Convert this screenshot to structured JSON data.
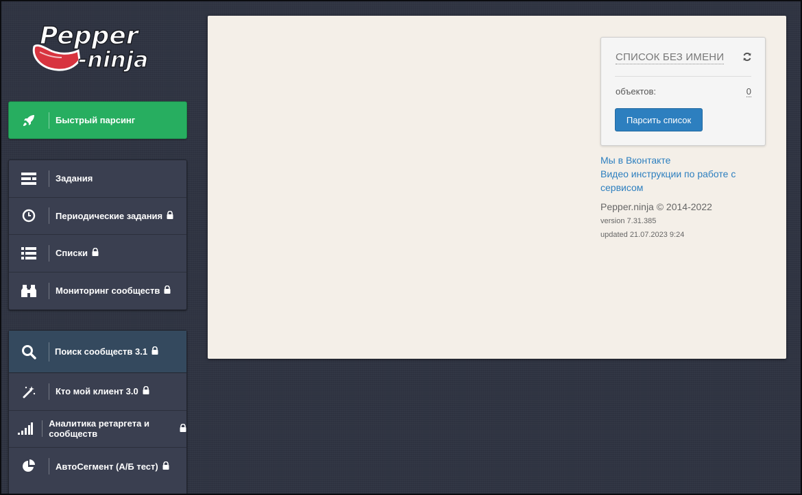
{
  "app": {
    "logo_text_line1": "Pepper",
    "logo_text_line2": "-ninja",
    "colors": {
      "sidebar_bg": "#2f3442",
      "menu_bg": "#3a3f50",
      "active_bg": "#34495e",
      "quick_green": "#27ae60",
      "content_bg": "#f4efe8",
      "link_blue": "#2d7fbf"
    }
  },
  "sidebar": {
    "quick": {
      "label": "Быстрый парсинг",
      "icon": "rocket-icon"
    },
    "group1": [
      {
        "label": "Задания",
        "icon": "tasks-icon",
        "locked": false
      },
      {
        "label": "Периодические задания",
        "icon": "clock-icon",
        "locked": true
      },
      {
        "label": "Списки",
        "icon": "list-icon",
        "locked": true
      },
      {
        "label": "Мониторинг сообществ",
        "icon": "binoculars-icon",
        "locked": true
      }
    ],
    "group2": [
      {
        "label": "Поиск сообществ 3.1",
        "icon": "search-icon",
        "locked": true,
        "active": true
      },
      {
        "label": "Кто мой клиент 3.0",
        "icon": "magic-wand-icon",
        "locked": true
      },
      {
        "label": "Аналитика ретаргета и сообществ",
        "icon": "signal-bars-icon",
        "locked": true
      },
      {
        "label": "АвтоСегмент (А/Б тест)",
        "icon": "pie-chart-icon",
        "locked": true
      }
    ]
  },
  "list_card": {
    "title": "СПИСОК БЕЗ ИМЕНИ",
    "count_label": "объектов:",
    "count_value": "0",
    "parse_button": "Парсить список"
  },
  "links": {
    "vk": "Мы в Вконтакте",
    "video_line1": "Видео инструкции по работе с",
    "video_line2": "сервисом"
  },
  "footer": {
    "copyright": "Pepper.ninja © 2014-2022",
    "version": "version 7.31.385",
    "updated": "updated 21.07.2023 9:24"
  }
}
